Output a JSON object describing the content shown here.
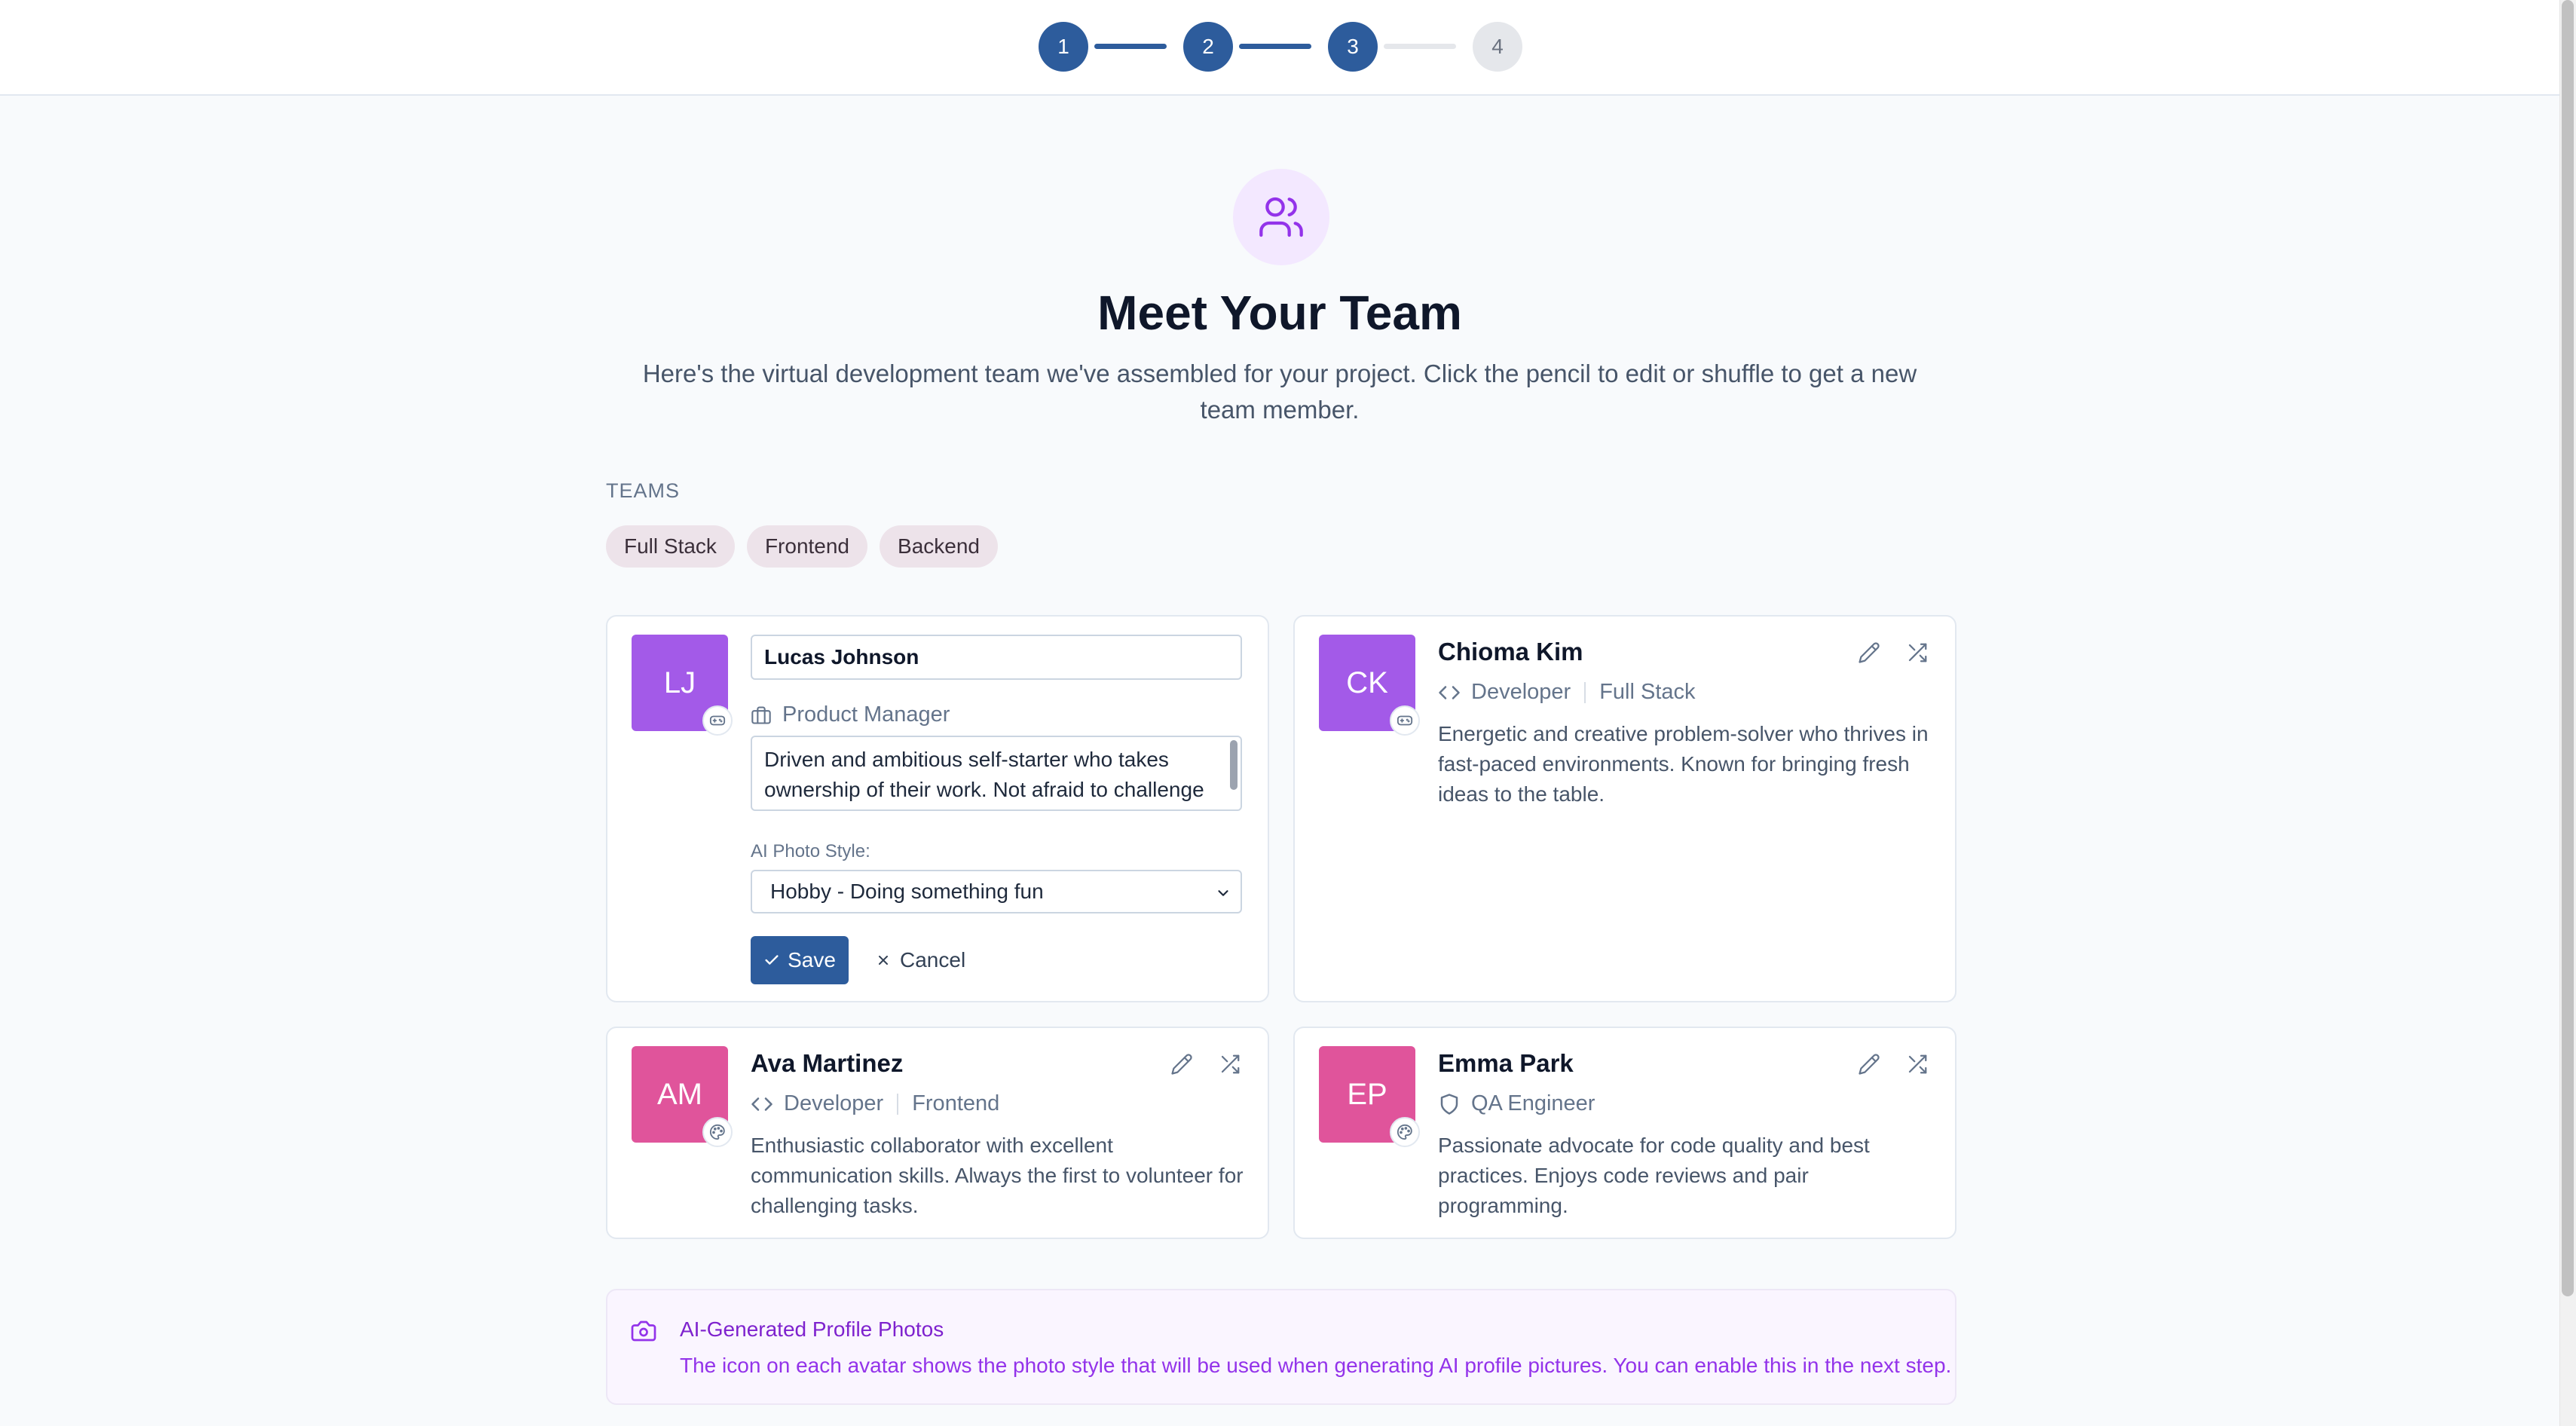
{
  "stepper": {
    "steps": [
      {
        "number": "1",
        "state": "done"
      },
      {
        "number": "2",
        "state": "done"
      },
      {
        "number": "3",
        "state": "done"
      },
      {
        "number": "4",
        "state": "todo"
      }
    ]
  },
  "header": {
    "title": "Meet Your Team",
    "subtitle": "Here's the virtual development team we've assembled for your project. Click the pencil to edit or shuffle to get a new team member."
  },
  "teams": {
    "label": "TEAMS",
    "chips": [
      "Full Stack",
      "Frontend",
      "Backend"
    ]
  },
  "editing_member": {
    "initials": "LJ",
    "avatar_color": "#a35ae8",
    "badge_icon": "gamepad-icon",
    "name_value": "Lucas Johnson",
    "role": "Product Manager",
    "role_icon": "briefcase-icon",
    "description_value": "Driven and ambitious self-starter who takes ownership of their work. Not afraid to challenge",
    "photo_style_label": "AI Photo Style:",
    "photo_style_value": "Hobby - Doing something fun",
    "save_label": "Save",
    "cancel_label": "Cancel"
  },
  "members": [
    {
      "initials": "CK",
      "avatar_color": "#a35ae8",
      "badge_icon": "gamepad-icon",
      "name": "Chioma Kim",
      "role": "Developer",
      "role_icon": "code-icon",
      "team": "Full Stack",
      "description": "Energetic and creative problem-solver who thrives in fast-paced environments. Known for bringing fresh ideas to the table."
    },
    {
      "initials": "AM",
      "avatar_color": "#e0549b",
      "badge_icon": "palette-icon",
      "name": "Ava Martinez",
      "role": "Developer",
      "role_icon": "code-icon",
      "team": "Frontend",
      "description": "Enthusiastic collaborator with excellent communication skills. Always the first to volunteer for challenging tasks."
    },
    {
      "initials": "EP",
      "avatar_color": "#e0549b",
      "badge_icon": "palette-icon",
      "name": "Emma Park",
      "role": "QA Engineer",
      "role_icon": "shield-icon",
      "team": "",
      "description": "Passionate advocate for code quality and best practices. Enjoys code reviews and pair programming."
    }
  ],
  "info": {
    "title": "AI-Generated Profile Photos",
    "text": "The icon on each avatar shows the photo style that will be used when generating AI profile pictures. You can enable this in the next step."
  },
  "colors": {
    "primary": "#2d5c9c",
    "accent_purple": "#a35ae8",
    "accent_pink": "#e0549b"
  }
}
